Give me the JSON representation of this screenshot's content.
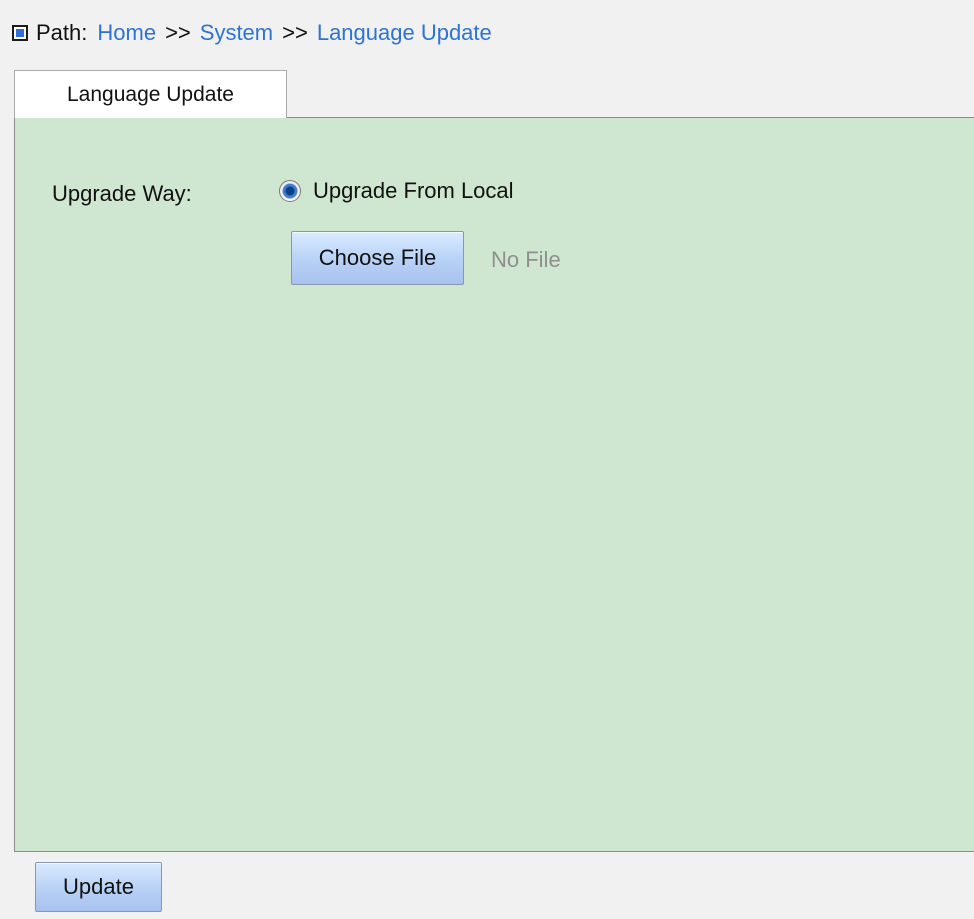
{
  "breadcrumb": {
    "icon": "path-icon",
    "label": "Path:",
    "items": [
      "Home",
      "System",
      "Language Update"
    ],
    "separator": ">>"
  },
  "tab": {
    "label": "Language Update"
  },
  "form": {
    "upgrade_way_label": "Upgrade Way:",
    "upgrade_option_label": "Upgrade From Local",
    "choose_file_label": "Choose File",
    "file_status": "No File"
  },
  "footer": {
    "update_label": "Update"
  },
  "colors": {
    "background": "#f1f1f1",
    "panel": "#cfe7d1",
    "link": "#2e73d4",
    "button_top": "#d9ebff",
    "button_bottom": "#a7c2ef"
  }
}
